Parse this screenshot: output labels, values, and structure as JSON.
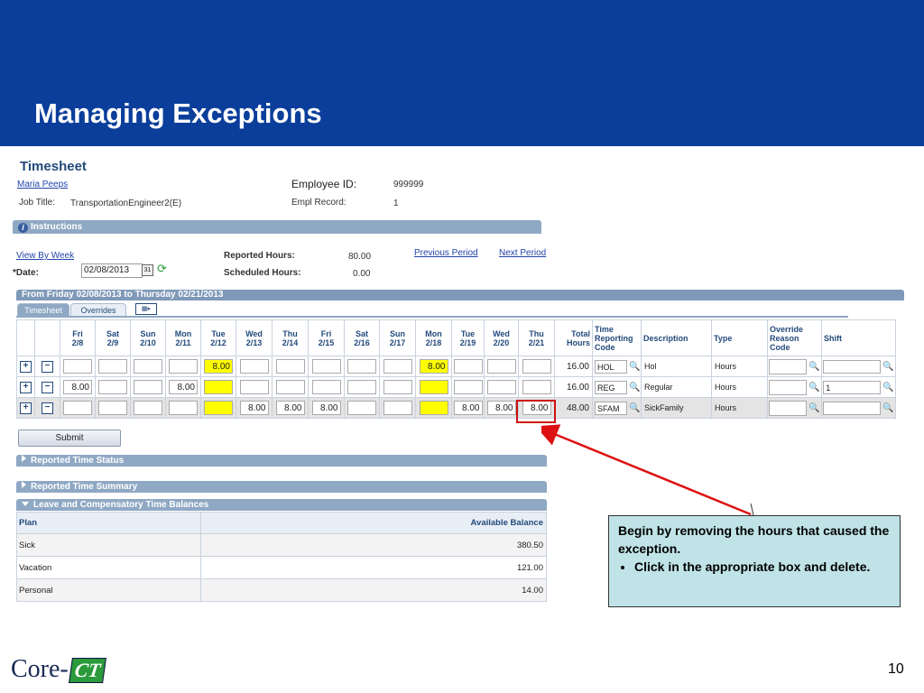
{
  "slide": {
    "title": "Managing Exceptions",
    "page_number": "10"
  },
  "timesheet": {
    "title": "Timesheet",
    "employee_name": "Maria Peeps",
    "job_title_label": "Job Title:",
    "job_title": "TransportationEngineer2(E)",
    "employee_id_label": "Employee ID:",
    "employee_id": "999999",
    "empl_record_label": "Empl Record:",
    "empl_record": "1",
    "instructions": "Instructions",
    "view_by": "View By Week",
    "date_label": "*Date:",
    "date_value": "02/08/2013",
    "reported_hours_label": "Reported Hours:",
    "reported_hours": "80.00",
    "scheduled_hours_label": "Scheduled Hours:",
    "scheduled_hours": "0.00",
    "previous_period": "Previous Period",
    "next_period": "Next Period",
    "period_bar": "From Friday 02/08/2013 to Thursday 02/21/2013",
    "tabs": [
      "Timesheet",
      "Overrides"
    ],
    "day_headers": [
      {
        "d": "Fri",
        "n": "2/8"
      },
      {
        "d": "Sat",
        "n": "2/9"
      },
      {
        "d": "Sun",
        "n": "2/10"
      },
      {
        "d": "Mon",
        "n": "2/11"
      },
      {
        "d": "Tue",
        "n": "2/12"
      },
      {
        "d": "Wed",
        "n": "2/13"
      },
      {
        "d": "Thu",
        "n": "2/14"
      },
      {
        "d": "Fri",
        "n": "2/15"
      },
      {
        "d": "Sat",
        "n": "2/16"
      },
      {
        "d": "Sun",
        "n": "2/17"
      },
      {
        "d": "Mon",
        "n": "2/18"
      },
      {
        "d": "Tue",
        "n": "2/19"
      },
      {
        "d": "Wed",
        "n": "2/20"
      },
      {
        "d": "Thu",
        "n": "2/21"
      }
    ],
    "col_total": "Total Hours",
    "col_trc": "Time Reporting Code",
    "col_desc": "Description",
    "col_type": "Type",
    "col_override": "Override Reason Code",
    "col_shift": "Shift",
    "rows": [
      {
        "cells": [
          "",
          "",
          "",
          "",
          "8.00",
          "",
          "",
          "",
          "",
          "",
          "8.00",
          "",
          "",
          ""
        ],
        "yellow": [
          4,
          10
        ],
        "total": "16.00",
        "trc": "HOL",
        "desc": "Hol",
        "type": "Hours",
        "shift": ""
      },
      {
        "cells": [
          "8.00",
          "",
          "",
          "8.00",
          "",
          "",
          "",
          "",
          "",
          "",
          "",
          "",
          "",
          ""
        ],
        "yellow": [
          4,
          10
        ],
        "total": "16.00",
        "trc": "REG",
        "desc": "Regular",
        "type": "Hours",
        "shift": "1"
      },
      {
        "cells": [
          "",
          "",
          "",
          "",
          "",
          "8.00",
          "8.00",
          "8.00",
          "",
          "",
          "",
          "8.00",
          "8.00",
          "8.00"
        ],
        "yellow": [
          4,
          10
        ],
        "total": "48.00",
        "trc": "SFAM",
        "desc": "SickFamily",
        "type": "Hours",
        "shift": ""
      }
    ],
    "submit": "Submit",
    "reported_time_status": "Reported Time Status",
    "reported_time_summary": "Reported Time Summary",
    "leave_title": "Leave and Compensatory Time Balances",
    "leave_cols": [
      "Plan",
      "Available Balance"
    ],
    "leave_rows": [
      {
        "plan": "Sick",
        "balance": "380.50"
      },
      {
        "plan": "Vacation",
        "balance": "121.00"
      },
      {
        "plan": "Personal",
        "balance": "14.00"
      }
    ]
  },
  "callout": {
    "text": "Begin by removing the hours that caused the exception.",
    "bullet": "Click in the appropriate box and delete."
  },
  "logo": {
    "text": "Core-",
    "badge": "CT"
  },
  "colors": {
    "header_bg": "#0a3e9a",
    "bar": "#8fa8c4",
    "highlight": "#ffff00",
    "arrow": "#dd1111",
    "callout_bg": "#bfe3e6"
  }
}
